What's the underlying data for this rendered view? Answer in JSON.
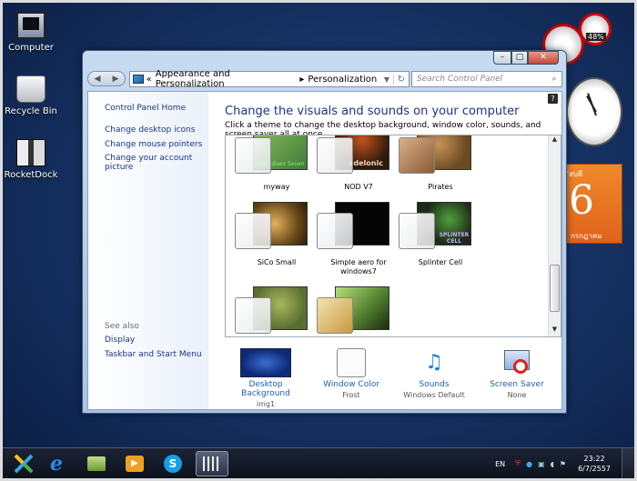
{
  "desktop": {
    "icons": [
      {
        "label": "Computer"
      },
      {
        "label": "Recycle Bin"
      },
      {
        "label": "RocketDock"
      }
    ],
    "gadgets": {
      "cpu_percent": "48%",
      "calendar_day_name": "ัสบดี",
      "calendar_day": "6",
      "calendar_month": "กรกฎาคม"
    }
  },
  "window": {
    "controls": {
      "minimize": "–",
      "maximize": "□",
      "close": "✕"
    },
    "nav": {
      "back": "◀",
      "forward": "▶"
    },
    "address": {
      "prefix": "«",
      "segments": [
        "Appearance and Personalization",
        "Personalization"
      ],
      "separator": "▸"
    },
    "search": {
      "placeholder": "Search Control Panel"
    },
    "sidebar": {
      "home": "Control Panel Home",
      "links": [
        "Change desktop icons",
        "Change mouse pointers",
        "Change your account picture"
      ],
      "see_also": "See also",
      "see_also_links": [
        "Display",
        "Taskbar and Start Menu"
      ]
    },
    "content": {
      "title": "Change the visuals and sounds on your computer",
      "subtitle": "Click a theme to change the desktop background, window color, sounds, and screen saver all at once.",
      "themes": [
        {
          "name": "myway",
          "art_text": "Windows Seven",
          "color": "#3f7a3a"
        },
        {
          "name": "NOD V7",
          "art_text": "adelonic",
          "color": "#2d1a0c"
        },
        {
          "name": "Pirates",
          "art_text": "",
          "color": "#6b4a22"
        },
        {
          "name": "SiCo Small",
          "art_text": "",
          "color": "#6a4a1a"
        },
        {
          "name": "Simple aero for windows7",
          "art_text": "",
          "color": "#050505"
        },
        {
          "name": "Splinter Cell",
          "art_text": "SPLINTER CELL",
          "color": "#1d2a1a"
        },
        {
          "name": "",
          "art_text": "",
          "color": "#5a6e32"
        },
        {
          "name": "",
          "art_text": "",
          "color": "#4d7a2c"
        }
      ],
      "bottom": [
        {
          "label": "Desktop Background",
          "value": "img1"
        },
        {
          "label": "Window Color",
          "value": "Frost"
        },
        {
          "label": "Sounds",
          "value": "Windows Default"
        },
        {
          "label": "Screen Saver",
          "value": "None"
        }
      ]
    }
  },
  "taskbar": {
    "language": "EN",
    "time": "23:22",
    "date": "6/7/2557"
  }
}
